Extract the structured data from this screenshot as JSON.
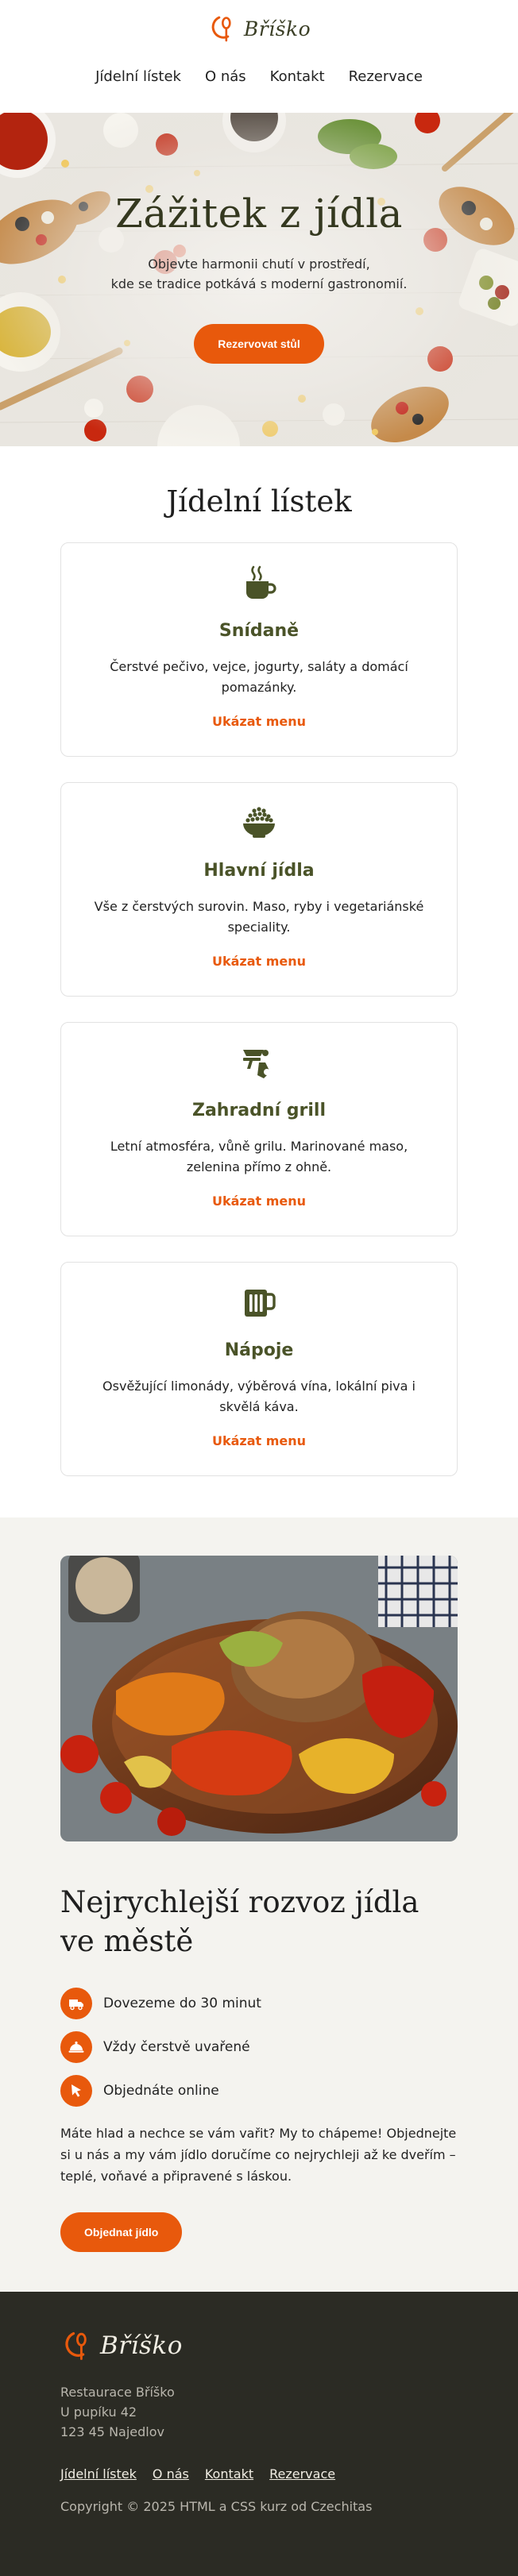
{
  "brand": {
    "name": "Bříško"
  },
  "nav": [
    "Jídelní lístek",
    "O nás",
    "Kontakt",
    "Rezervace"
  ],
  "hero": {
    "title": "Zážitek z jídla",
    "subtitle_line1": "Objevte harmonii chutí v prostředí,",
    "subtitle_line2": "kde se tradice potkává s moderní gastronomií.",
    "button": "Rezervovat stůl"
  },
  "menu": {
    "title": "Jídelní lístek",
    "link_label": "Ukázat menu",
    "cards": [
      {
        "icon": "coffee-cup-icon",
        "title": "Snídaně",
        "text": "Čerstvé pečivo, vejce, jogurty, saláty a domácí pomazánky."
      },
      {
        "icon": "food-bowl-icon",
        "title": "Hlavní jídla",
        "text": "Vše z čerstvých surovin. Maso, ryby i vegetariánské speciality."
      },
      {
        "icon": "grill-icon",
        "title": "Zahradní grill",
        "text": "Letní atmosféra, vůně grilu. Marinované maso, zelenina přímo z ohně."
      },
      {
        "icon": "beer-mug-icon",
        "title": "Nápoje",
        "text": "Osvěžující limonády, výběrová vína, lokální piva i skvělá káva."
      }
    ]
  },
  "delivery": {
    "title": "Nejrychlejší rozvoz jídla ve městě",
    "features": [
      {
        "icon": "truck-icon",
        "label": "Dovezeme do 30 minut"
      },
      {
        "icon": "cloche-icon",
        "label": "Vždy čerstvě uvařené"
      },
      {
        "icon": "pointer-icon",
        "label": "Objednáte online"
      }
    ],
    "text": "Máte hlad a nechce se vám vařit? My to chápeme! Objednejte si u nás a my vám jídlo doručíme co nejrychleji až ke dveřím – teplé, voňavé a připravené s láskou.",
    "button": "Objednat jídlo"
  },
  "footer": {
    "address": [
      "Restaurace Bříško",
      "U pupíku 42",
      "123 45 Najedlov"
    ],
    "nav": [
      "Jídelní lístek",
      "O nás",
      "Kontakt",
      "Rezervace"
    ],
    "copyright": "Copyright © 2025 HTML a CSS kurz od Czechitas"
  },
  "colors": {
    "accent": "#e8590c",
    "olive": "#4a5328",
    "footer_bg": "#2b2b24",
    "section_bg": "#f4f3ef"
  }
}
